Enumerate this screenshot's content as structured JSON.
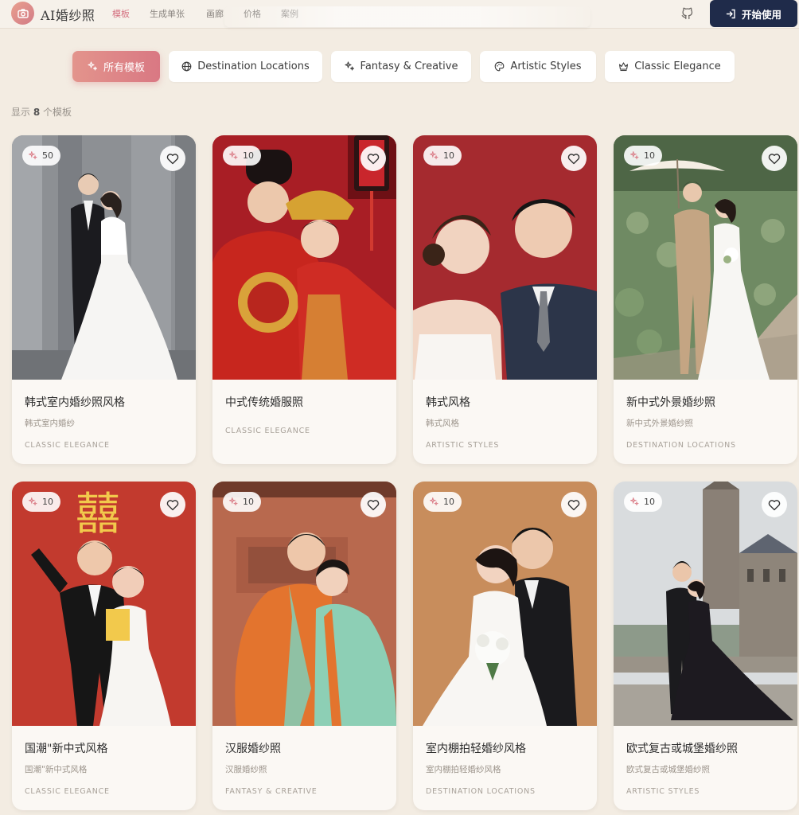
{
  "header": {
    "logo_text": "AI婚纱照",
    "nav": [
      "模板",
      "生成单张",
      "画廊",
      "价格",
      "案例"
    ],
    "start_label": "开始使用"
  },
  "filters": [
    {
      "label": "所有模板",
      "icon": "sparkles-icon",
      "active": true
    },
    {
      "label": "Destination Locations",
      "icon": "globe-icon",
      "active": false
    },
    {
      "label": "Fantasy & Creative",
      "icon": "sparkles-icon",
      "active": false
    },
    {
      "label": "Artistic Styles",
      "icon": "palette-icon",
      "active": false
    },
    {
      "label": "Classic Elegance",
      "icon": "crown-icon",
      "active": false
    }
  ],
  "count": {
    "prefix": "显示",
    "number": "8",
    "suffix": "个模板"
  },
  "cards": [
    {
      "likes": "50",
      "title": "韩式室内婚纱照风格",
      "subtitle": "韩式室内婚纱",
      "category": "CLASSIC ELEGANCE"
    },
    {
      "likes": "10",
      "title": "中式传统婚服照",
      "subtitle": "",
      "category": "CLASSIC ELEGANCE"
    },
    {
      "likes": "10",
      "title": "韩式风格",
      "subtitle": "韩式风格",
      "category": "ARTISTIC STYLES"
    },
    {
      "likes": "10",
      "title": "新中式外景婚纱照",
      "subtitle": "新中式外景婚纱照",
      "category": "DESTINATION LOCATIONS"
    },
    {
      "likes": "10",
      "title": "国潮\"新中式风格",
      "subtitle": "国潮\"新中式风格",
      "category": "CLASSIC ELEGANCE"
    },
    {
      "likes": "10",
      "title": "汉服婚纱照",
      "subtitle": "汉服婚纱照",
      "category": "FANTASY & CREATIVE"
    },
    {
      "likes": "10",
      "title": "室内棚拍轻婚纱风格",
      "subtitle": "室内棚拍轻婚纱风格",
      "category": "DESTINATION LOCATIONS"
    },
    {
      "likes": "10",
      "title": "欧式复古或城堡婚纱照",
      "subtitle": "欧式复古或城堡婚纱照",
      "category": "ARTISTIC STYLES"
    }
  ],
  "colors": {
    "accent": "#d97883",
    "background": "#f3ece2",
    "button_dark": "#1f2b4a"
  }
}
